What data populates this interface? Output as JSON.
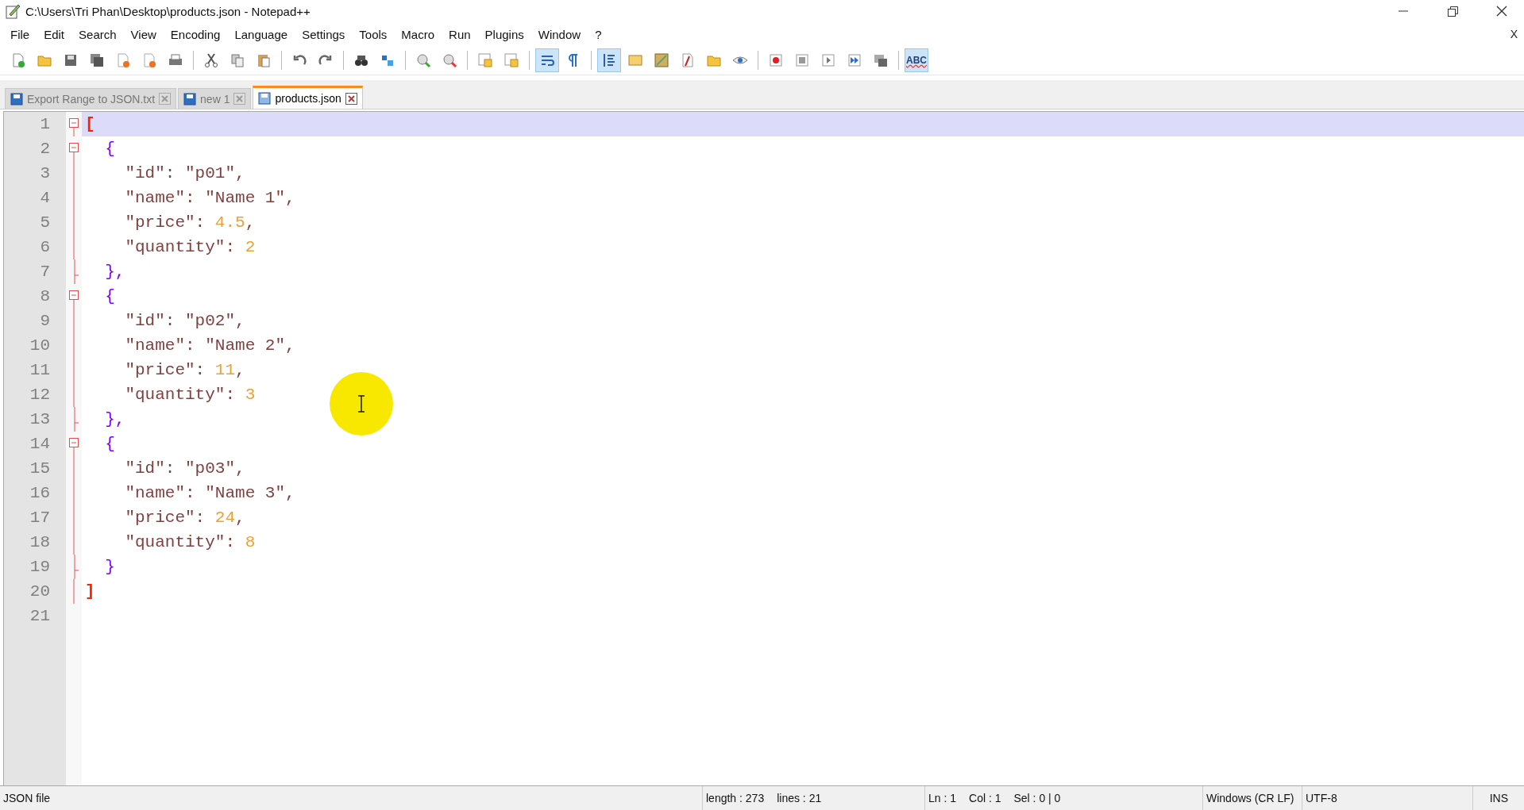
{
  "window": {
    "title": "C:\\Users\\Tri Phan\\Desktop\\products.json - Notepad++"
  },
  "menu": [
    "File",
    "Edit",
    "Search",
    "View",
    "Encoding",
    "Language",
    "Settings",
    "Tools",
    "Macro",
    "Run",
    "Plugins",
    "Window",
    "?"
  ],
  "menu_close": "X",
  "toolbar": [
    {
      "kind": "new"
    },
    {
      "kind": "open"
    },
    {
      "kind": "save"
    },
    {
      "kind": "saveall"
    },
    {
      "kind": "close"
    },
    {
      "kind": "closeall"
    },
    {
      "kind": "print"
    },
    {
      "kind": "sep"
    },
    {
      "kind": "cut"
    },
    {
      "kind": "copy"
    },
    {
      "kind": "paste"
    },
    {
      "kind": "sep"
    },
    {
      "kind": "undo"
    },
    {
      "kind": "redo"
    },
    {
      "kind": "sep"
    },
    {
      "kind": "find"
    },
    {
      "kind": "replace"
    },
    {
      "kind": "sep"
    },
    {
      "kind": "zoomin"
    },
    {
      "kind": "zoomout"
    },
    {
      "kind": "sep"
    },
    {
      "kind": "syncv"
    },
    {
      "kind": "synch"
    },
    {
      "kind": "sep"
    },
    {
      "kind": "wrap",
      "on": true
    },
    {
      "kind": "allchars",
      "on": false
    },
    {
      "kind": "sep"
    },
    {
      "kind": "indent",
      "on": true
    },
    {
      "kind": "udl"
    },
    {
      "kind": "docmap"
    },
    {
      "kind": "funclist"
    },
    {
      "kind": "folder"
    },
    {
      "kind": "monitor"
    },
    {
      "kind": "sep"
    },
    {
      "kind": "record"
    },
    {
      "kind": "stop"
    },
    {
      "kind": "play"
    },
    {
      "kind": "playmulti"
    },
    {
      "kind": "savemacro"
    },
    {
      "kind": "sep"
    },
    {
      "kind": "spell",
      "label": "ABC",
      "on": true
    }
  ],
  "tabs": [
    {
      "label": "Export Range to JSON.txt",
      "selected": false
    },
    {
      "label": "new 1",
      "selected": false
    },
    {
      "label": "products.json",
      "selected": true
    }
  ],
  "editor": {
    "lines": [
      {
        "number": "1",
        "current": true,
        "fold": {
          "kind": "open"
        },
        "tokens": [
          {
            "kind": "bracket",
            "text": "["
          }
        ]
      },
      {
        "number": "2",
        "current": false,
        "fold": {
          "kind": "open"
        },
        "tokens": [
          {
            "kind": "brace",
            "text": "  {"
          }
        ]
      },
      {
        "number": "3",
        "current": false,
        "fold": {
          "kind": "line"
        },
        "tokens": [
          {
            "kind": "text",
            "text": "    \"id\": \"p01\","
          }
        ]
      },
      {
        "number": "4",
        "current": false,
        "fold": {
          "kind": "line"
        },
        "tokens": [
          {
            "kind": "text",
            "text": "    \"name\": \"Name 1\","
          }
        ]
      },
      {
        "number": "5",
        "current": false,
        "fold": {
          "kind": "line"
        },
        "tokens": [
          {
            "kind": "text",
            "text": "    \"price\": "
          },
          {
            "kind": "number",
            "text": "4.5"
          },
          {
            "kind": "text",
            "text": ","
          }
        ]
      },
      {
        "number": "6",
        "current": false,
        "fold": {
          "kind": "line"
        },
        "tokens": [
          {
            "kind": "text",
            "text": "    \"quantity\": "
          },
          {
            "kind": "number",
            "text": "2"
          }
        ]
      },
      {
        "number": "7",
        "current": false,
        "fold": {
          "kind": "tail"
        },
        "tokens": [
          {
            "kind": "brace",
            "text": "  },"
          }
        ]
      },
      {
        "number": "8",
        "current": false,
        "fold": {
          "kind": "open"
        },
        "tokens": [
          {
            "kind": "brace",
            "text": "  {"
          }
        ]
      },
      {
        "number": "9",
        "current": false,
        "fold": {
          "kind": "line"
        },
        "tokens": [
          {
            "kind": "text",
            "text": "    \"id\": \"p02\","
          }
        ]
      },
      {
        "number": "10",
        "current": false,
        "fold": {
          "kind": "line"
        },
        "tokens": [
          {
            "kind": "text",
            "text": "    \"name\": \"Name 2\","
          }
        ]
      },
      {
        "number": "11",
        "current": false,
        "fold": {
          "kind": "line"
        },
        "tokens": [
          {
            "kind": "text",
            "text": "    \"price\": "
          },
          {
            "kind": "number",
            "text": "11"
          },
          {
            "kind": "text",
            "text": ","
          }
        ]
      },
      {
        "number": "12",
        "current": false,
        "fold": {
          "kind": "line"
        },
        "tokens": [
          {
            "kind": "text",
            "text": "    \"quantity\": "
          },
          {
            "kind": "number",
            "text": "3"
          }
        ]
      },
      {
        "number": "13",
        "current": false,
        "fold": {
          "kind": "tail"
        },
        "tokens": [
          {
            "kind": "brace",
            "text": "  },"
          }
        ]
      },
      {
        "number": "14",
        "current": false,
        "fold": {
          "kind": "open"
        },
        "tokens": [
          {
            "kind": "brace",
            "text": "  {"
          }
        ]
      },
      {
        "number": "15",
        "current": false,
        "fold": {
          "kind": "line"
        },
        "tokens": [
          {
            "kind": "text",
            "text": "    \"id\": \"p03\","
          }
        ]
      },
      {
        "number": "16",
        "current": false,
        "fold": {
          "kind": "line"
        },
        "tokens": [
          {
            "kind": "text",
            "text": "    \"name\": \"Name 3\","
          }
        ]
      },
      {
        "number": "17",
        "current": false,
        "fold": {
          "kind": "line"
        },
        "tokens": [
          {
            "kind": "text",
            "text": "    \"price\": "
          },
          {
            "kind": "number",
            "text": "24"
          },
          {
            "kind": "text",
            "text": ","
          }
        ]
      },
      {
        "number": "18",
        "current": false,
        "fold": {
          "kind": "line"
        },
        "tokens": [
          {
            "kind": "text",
            "text": "    \"quantity\": "
          },
          {
            "kind": "number",
            "text": "8"
          }
        ]
      },
      {
        "number": "19",
        "current": false,
        "fold": {
          "kind": "tail"
        },
        "tokens": [
          {
            "kind": "brace",
            "text": "  }"
          }
        ]
      },
      {
        "number": "20",
        "current": false,
        "fold": {
          "kind": "end"
        },
        "tokens": [
          {
            "kind": "bracket",
            "text": "]"
          }
        ]
      },
      {
        "number": "21",
        "current": false
      }
    ]
  },
  "status_bar": {
    "file_type": "JSON file",
    "length": "length : 273",
    "lines": "lines : 21",
    "ln": "Ln : 1",
    "col": "Col : 1",
    "sel": "Sel : 0 | 0",
    "eol": "Windows (CR LF)",
    "encoding": "UTF-8",
    "mode": "INS"
  }
}
